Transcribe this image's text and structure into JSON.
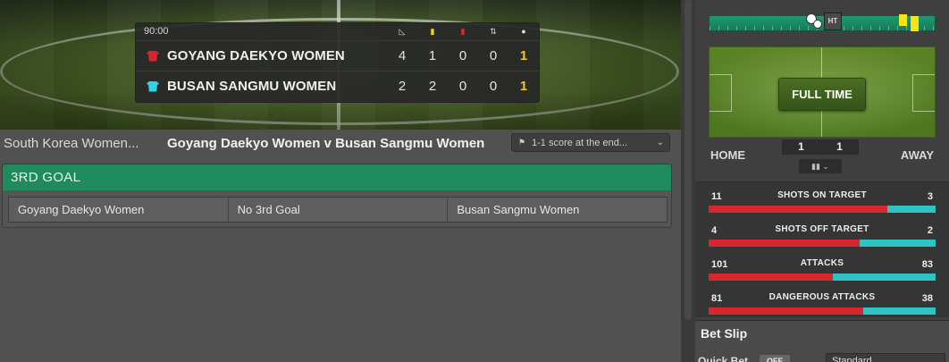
{
  "scoreboard": {
    "clock": "90:00",
    "stat_icons": [
      "corner-icon",
      "yellow-card-icon",
      "red-card-icon",
      "substitution-icon",
      "goal-ball-icon"
    ],
    "teams": [
      {
        "name": "GOYANG DAEKYO WOMEN",
        "shirt_color": "#d8262e",
        "corners": "4",
        "yellow": "1",
        "red": "0",
        "subs": "0",
        "goals": "1"
      },
      {
        "name": "BUSAN SANGMU WOMEN",
        "shirt_color": "#2fd2e4",
        "corners": "2",
        "yellow": "2",
        "red": "0",
        "subs": "0",
        "goals": "1"
      }
    ]
  },
  "match_bar": {
    "competition": "South Korea Women...",
    "title": "Goyang Daekyo Women v Busan Sangmu Women",
    "stat_filter": "1-1 score at the end..."
  },
  "market": {
    "name": "3RD GOAL",
    "selections": [
      "Goyang Daekyo Women",
      "No 3rd Goal",
      "Busan Sangmu Women"
    ]
  },
  "tracker": {
    "ht_label": "HT",
    "status": "FULL TIME",
    "home_label": "HOME",
    "away_label": "AWAY",
    "home_score": "1",
    "away_score": "1",
    "chart_button": "▮▮ ⌄"
  },
  "stats": [
    {
      "label": "SHOTS ON TARGET",
      "home": "11",
      "away": "3",
      "home_fraction": 0.7857
    },
    {
      "label": "SHOTS OFF TARGET",
      "home": "4",
      "away": "2",
      "home_fraction": 0.6667
    },
    {
      "label": "ATTACKS",
      "home": "101",
      "away": "83",
      "home_fraction": 0.5489
    },
    {
      "label": "DANGEROUS ATTACKS",
      "home": "81",
      "away": "38",
      "home_fraction": 0.6807
    }
  ],
  "betslip": {
    "title": "Bet Slip",
    "quick_bet_label": "Quick Bet",
    "quick_bet_state": "OFF",
    "mode": "Standard"
  },
  "colors": {
    "market_header": "#1f8a5e",
    "home_bar": "#d8262e",
    "away_bar": "#2fc4c4",
    "goals": "#f2c81c"
  }
}
